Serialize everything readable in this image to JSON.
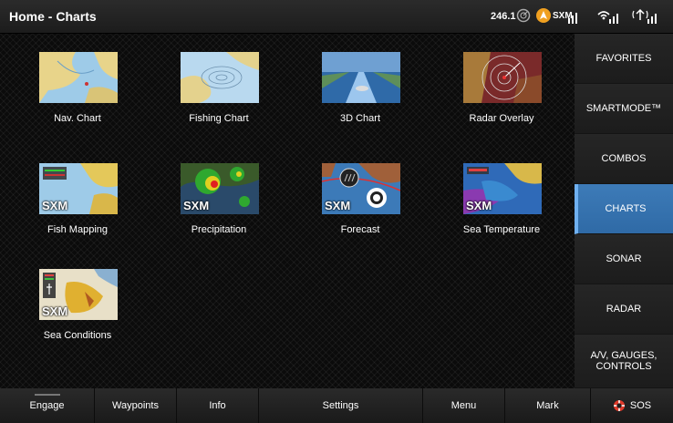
{
  "header": {
    "title": "Home - Charts",
    "speed": "246.1",
    "sxm_label": "SXM"
  },
  "tiles": [
    {
      "label": "Nav. Chart",
      "icon": "nav-chart-icon"
    },
    {
      "label": "Fishing Chart",
      "icon": "fishing-chart-icon"
    },
    {
      "label": "3D Chart",
      "icon": "3d-chart-icon"
    },
    {
      "label": "Radar Overlay",
      "icon": "radar-overlay-icon"
    },
    {
      "label": "Fish Mapping",
      "icon": "fish-mapping-icon",
      "badge": "SXM"
    },
    {
      "label": "Precipitation",
      "icon": "precipitation-icon",
      "badge": "SXM"
    },
    {
      "label": "Forecast",
      "icon": "forecast-icon",
      "badge": "SXM"
    },
    {
      "label": "Sea Temperature",
      "icon": "sea-temperature-icon",
      "badge": "SXM"
    },
    {
      "label": "Sea Conditions",
      "icon": "sea-conditions-icon",
      "badge": "SXM"
    }
  ],
  "sidebar": {
    "items": [
      {
        "label": "FAVORITES"
      },
      {
        "label": "SMARTMODE™"
      },
      {
        "label": "COMBOS"
      },
      {
        "label": "CHARTS",
        "active": true
      },
      {
        "label": "SONAR"
      },
      {
        "label": "RADAR"
      },
      {
        "label": "A/V, GAUGES, CONTROLS"
      }
    ]
  },
  "bottom": {
    "engage": "Engage",
    "waypoints": "Waypoints",
    "info": "Info",
    "settings": "Settings",
    "menu": "Menu",
    "mark": "Mark",
    "sos": "SOS"
  },
  "colors": {
    "accent": "#3d7bb8",
    "sos": "#e03a2a",
    "nav_icon": "#f0a020"
  }
}
